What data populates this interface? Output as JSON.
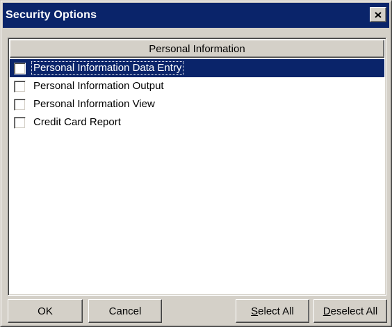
{
  "window": {
    "title": "Security Options"
  },
  "list": {
    "column_header": "Personal Information",
    "items": [
      {
        "label": "Personal Information Data Entry",
        "checked": false,
        "selected": true
      },
      {
        "label": "Personal Information Output",
        "checked": false,
        "selected": false
      },
      {
        "label": "Personal Information View",
        "checked": false,
        "selected": false
      },
      {
        "label": "Credit Card Report",
        "checked": false,
        "selected": false
      }
    ]
  },
  "buttons": {
    "ok": "OK",
    "cancel": "Cancel",
    "select_all_access": "S",
    "select_all_rest": "elect All",
    "deselect_all_access": "D",
    "deselect_all_rest": "eselect All"
  },
  "colors": {
    "title_bar": "#0a246a",
    "face": "#d4d0c8",
    "selection": "#0a246a"
  },
  "icons": {
    "close": "close-icon"
  }
}
